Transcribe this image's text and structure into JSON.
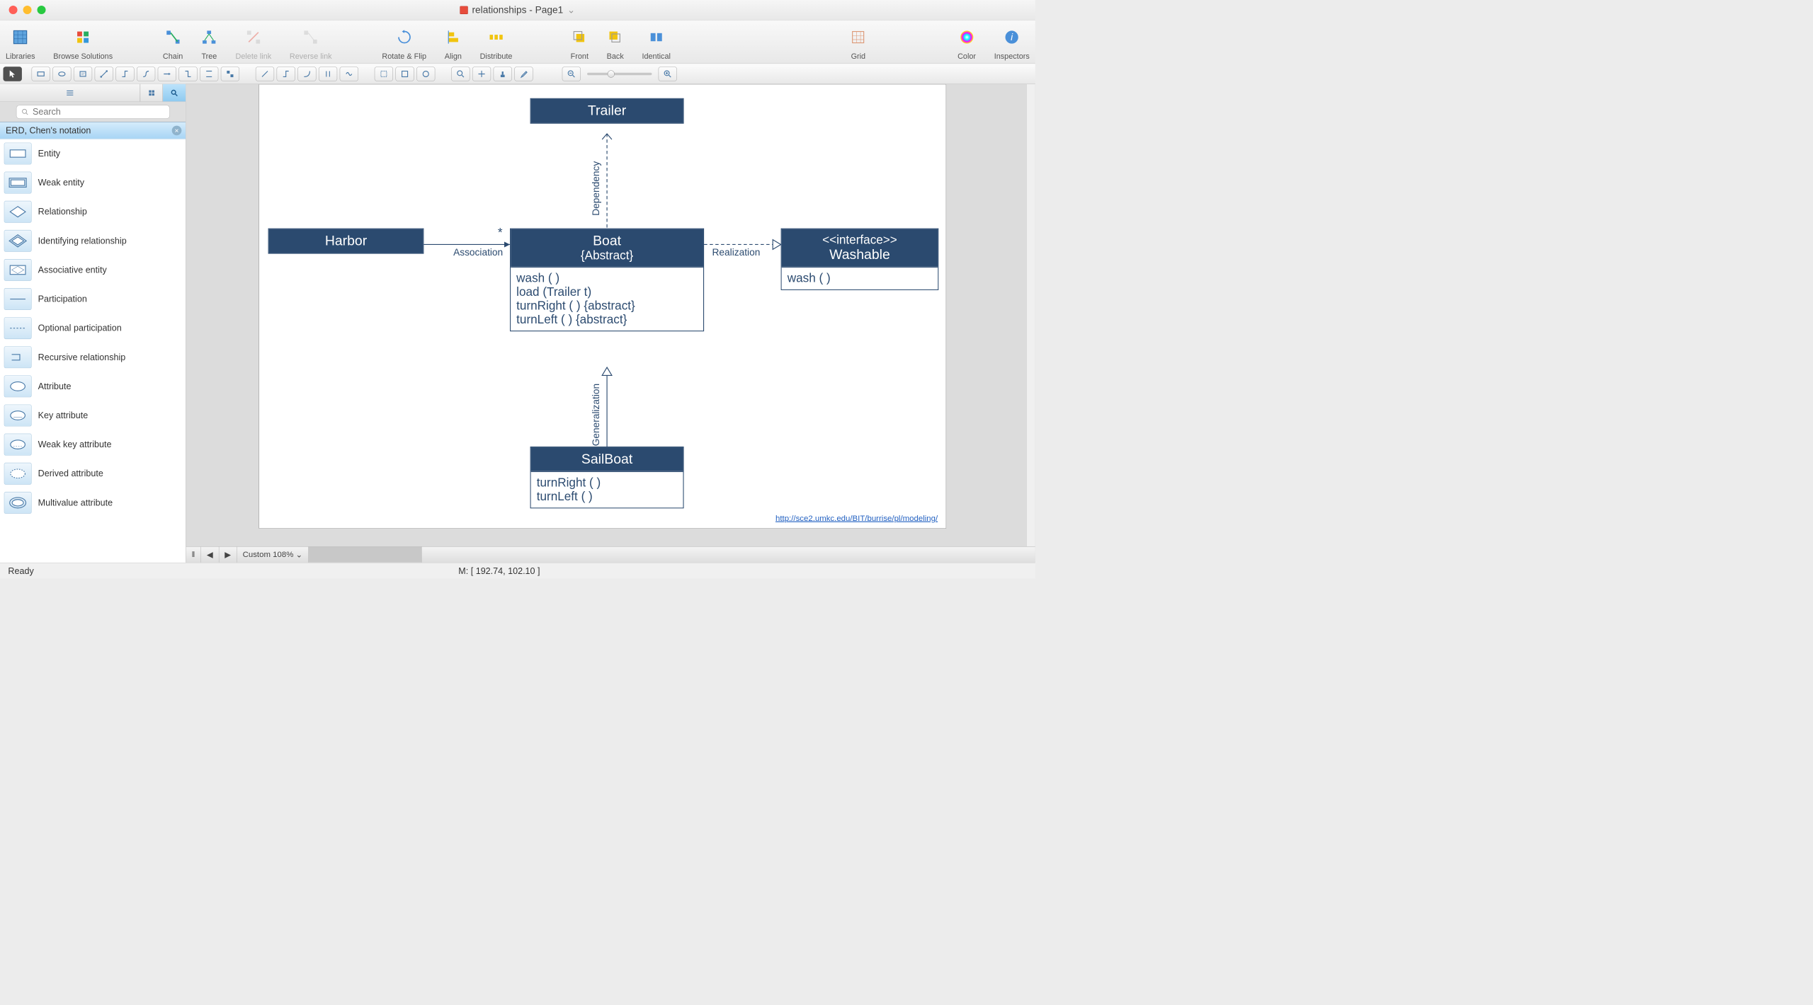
{
  "window": {
    "title": "relationships - Page1"
  },
  "toolbar1": {
    "libraries": "Libraries",
    "browse": "Browse Solutions",
    "chain": "Chain",
    "tree": "Tree",
    "delete": "Delete link",
    "reverse": "Reverse link",
    "rotate": "Rotate & Flip",
    "align": "Align",
    "distribute": "Distribute",
    "front": "Front",
    "back": "Back",
    "identical": "Identical",
    "grid": "Grid",
    "color": "Color",
    "inspectors": "Inspectors"
  },
  "sidebar": {
    "search_placeholder": "Search",
    "section": "ERD, Chen's notation",
    "items": [
      "Entity",
      "Weak entity",
      "Relationship",
      "Identifying relationship",
      "Associative entity",
      "Participation",
      "Optional participation",
      "Recursive relationship",
      "Attribute",
      "Key attribute",
      "Weak key attribute",
      "Derived attribute",
      "Multivalue attribute"
    ]
  },
  "chart_data": {
    "type": "diagram",
    "diagram_kind": "UML class",
    "nodes": [
      {
        "id": "trailer",
        "name": "Trailer",
        "stereotype": null,
        "operations": []
      },
      {
        "id": "harbor",
        "name": "Harbor",
        "stereotype": null,
        "operations": []
      },
      {
        "id": "boat",
        "name": "Boat",
        "modifier": "{Abstract}",
        "operations": [
          "wash ( )",
          "load (Trailer t)",
          "turnRight ( ) {abstract}",
          "turnLeft ( ) {abstract}"
        ]
      },
      {
        "id": "washable",
        "name": "Washable",
        "stereotype": "<<interface>>",
        "operations": [
          "wash ( )"
        ]
      },
      {
        "id": "sailboat",
        "name": "SailBoat",
        "operations": [
          "turnRight ( )",
          "turnLeft ( )"
        ]
      }
    ],
    "edges": [
      {
        "from": "harbor",
        "to": "boat",
        "type": "Association",
        "multiplicity": "*"
      },
      {
        "from": "boat",
        "to": "trailer",
        "type": "Dependency"
      },
      {
        "from": "boat",
        "to": "washable",
        "type": "Realization"
      },
      {
        "from": "sailboat",
        "to": "boat",
        "type": "Generalization"
      }
    ],
    "footer_link": "http://sce2.umkc.edu/BIT/burrise/pl/modeling/"
  },
  "bottombar": {
    "zoom": "Custom 108%"
  },
  "status": {
    "ready": "Ready",
    "mouse": "M: [ 192.74, 102.10 ]"
  }
}
